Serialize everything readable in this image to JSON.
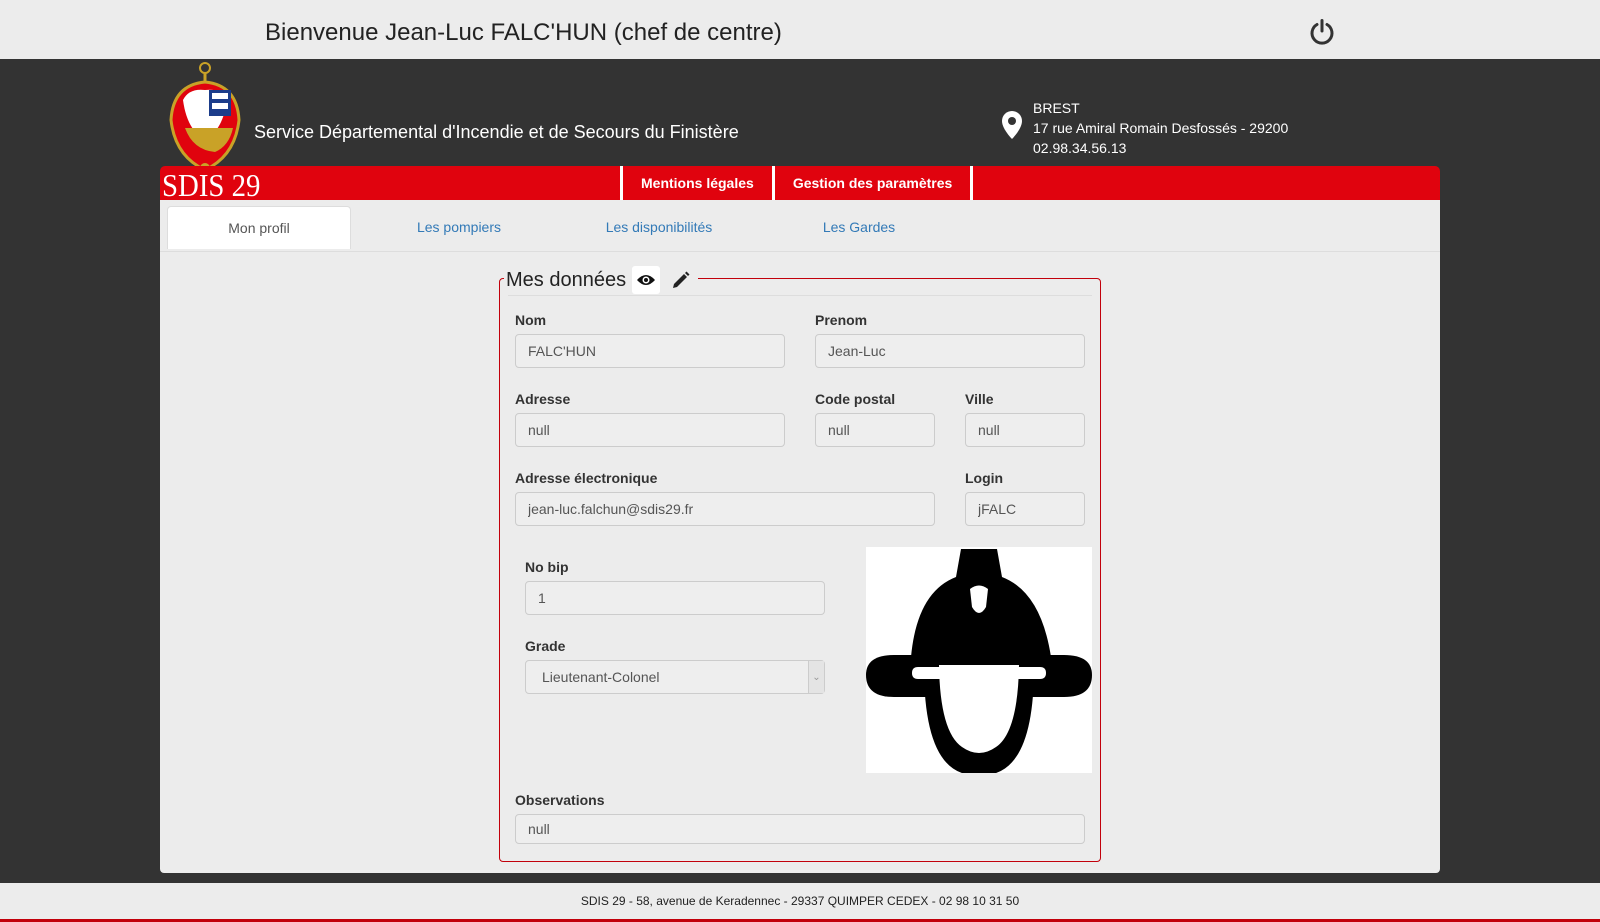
{
  "topbar": {
    "welcome": "Bienvenue Jean-Luc FALC'HUN (chef de centre)",
    "power_icon": "power-icon"
  },
  "header": {
    "service_title": "Service Départemental d'Incendie et de Secours du Finistère",
    "logo_text": "SDIS 29",
    "address": {
      "city": "BREST",
      "street": "17 rue Amiral Romain Desfossés - 29200",
      "phone": "02.98.34.56.13"
    }
  },
  "nav": {
    "links": [
      "Mentions légales",
      "Gestion des paramètres"
    ],
    "accent_color": "#e0030e"
  },
  "tabs": [
    {
      "label": "Mon profil",
      "active": true
    },
    {
      "label": "Les pompiers",
      "active": false
    },
    {
      "label": "Les disponibilités",
      "active": false
    },
    {
      "label": "Les Gardes",
      "active": false
    }
  ],
  "profile": {
    "legend": "Mes données",
    "fields": {
      "nom": {
        "label": "Nom",
        "value": "FALC'HUN"
      },
      "prenom": {
        "label": "Prenom",
        "value": "Jean-Luc"
      },
      "adresse": {
        "label": "Adresse",
        "value": "null"
      },
      "code_postal": {
        "label": "Code postal",
        "value": "null"
      },
      "ville": {
        "label": "Ville",
        "value": "null"
      },
      "email": {
        "label": "Adresse électronique",
        "value": "jean-luc.falchun@sdis29.fr"
      },
      "login": {
        "label": "Login",
        "value": "jFALC"
      },
      "no_bip": {
        "label": "No bip",
        "value": "1"
      },
      "grade": {
        "label": "Grade",
        "value": "Lieutenant-Colonel"
      },
      "observations": {
        "label": "Observations",
        "value": "null"
      }
    },
    "avatar_icon": "firefighter-helmet-icon"
  },
  "footer": {
    "text": "SDIS 29 - 58, avenue de Keradennec - 29337 QUIMPER CEDEX - 02 98 10 31 50"
  }
}
